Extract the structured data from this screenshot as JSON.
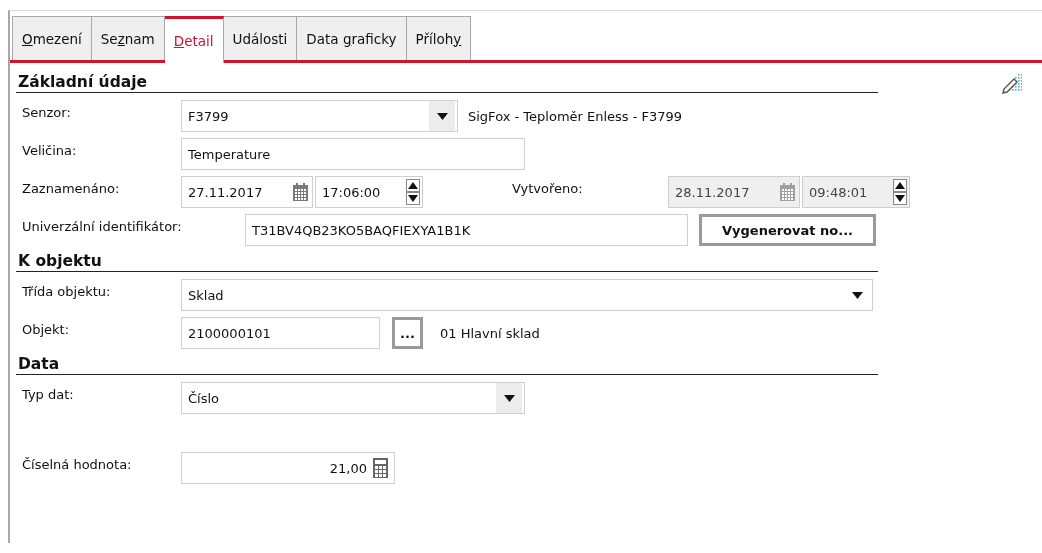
{
  "tabs": [
    {
      "hotkey": "O",
      "label_after": "mezení",
      "selected": false
    },
    {
      "label_before": "Se",
      "hotkey": "z",
      "label_after": "nam",
      "selected": false
    },
    {
      "hotkey": "D",
      "label_after": "etail",
      "selected": true
    },
    {
      "label_before": "Události",
      "selected": false
    },
    {
      "label_before": "Data ",
      "hotkey": "g",
      "label_after": "raficky",
      "selected": false
    },
    {
      "label_before": "Příloh",
      "hotkey": "y",
      "selected": false
    }
  ],
  "sections": [
    {
      "title": "Základní údaje",
      "rows": [
        {
          "kind": "combo",
          "label": "Senzor:",
          "value": "F3799",
          "note": "SigFox - Teploměr Enless - F3799"
        },
        {
          "kind": "text",
          "label": "Veličina:",
          "value": "Temperature"
        },
        {
          "kind": "datetime",
          "label": "Zaznamenáno:",
          "date": "27.11.2017",
          "time": "17:06:00",
          "disabled": false,
          "second": {
            "label": "Vytvořeno:",
            "date": "28.11.2017",
            "time": "09:48:01",
            "disabled": true
          }
        },
        {
          "kind": "text_button",
          "label": "Univerzální identifikátor:",
          "value": "T31BV4QB23KO5BAQFIEXYA1B1K",
          "button": "Vygenerovat no..."
        }
      ]
    },
    {
      "title": "K objektu",
      "rows": [
        {
          "kind": "wide_combo",
          "label": "Třída objektu:",
          "value": "Sklad"
        },
        {
          "kind": "lookup",
          "label": "Objekt:",
          "value": "2100000101",
          "button": "...",
          "note": "01 Hlavní sklad"
        }
      ]
    },
    {
      "title": "Data",
      "rows": [
        {
          "kind": "combo",
          "label": "Typ dat:",
          "value": "Číslo"
        },
        {
          "kind": "number",
          "label": "Číselná hodnota:",
          "value": "21,00",
          "gap_before": true
        }
      ]
    }
  ]
}
